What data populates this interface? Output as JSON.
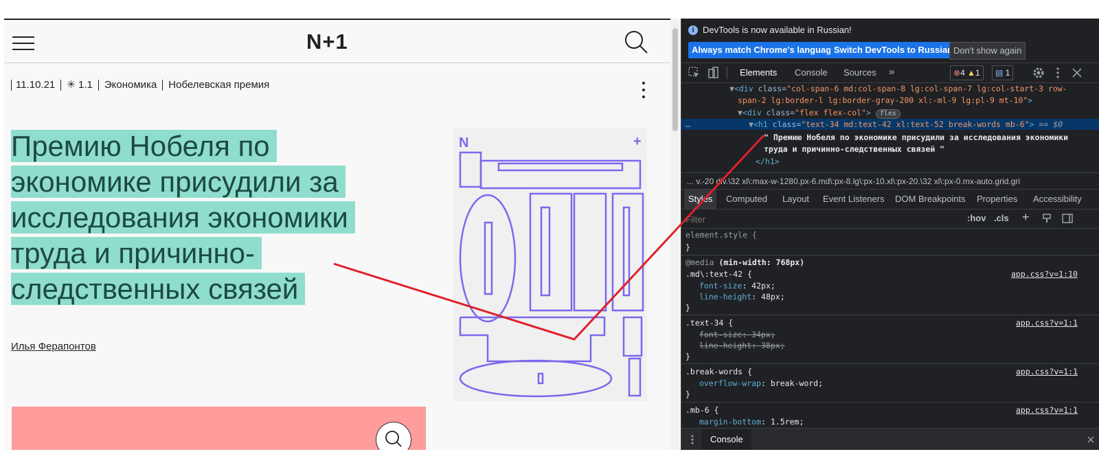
{
  "site": {
    "logo": "N+1",
    "meta": {
      "date": "11.10.21",
      "rating_icon": "asterisk-icon",
      "rating": "1.1",
      "rubric": "Экономика",
      "tag": "Нобелевская премия"
    },
    "title_lines": [
      "Премию Нобеля по",
      "экономике присудили за",
      "исследования экономики",
      "труда и причинно-",
      "следственных связей"
    ],
    "author": "Илья Ферапонтов",
    "poster": {
      "corner_left": "N",
      "corner_right": "+",
      "stroke_color": "#7b68ee"
    },
    "highlight_color": "#8fddcd",
    "pink_block_color": "#ff9c9c"
  },
  "devtools": {
    "infobar": {
      "message": "DevTools is now available in Russian!",
      "btn_match": "Always match Chrome's language",
      "btn_switch": "Switch DevTools to Russian",
      "btn_dismiss": "Don't show again"
    },
    "tabs": {
      "elements": "Elements",
      "console": "Console",
      "sources": "Sources",
      "more": "»"
    },
    "badges": {
      "errors": "4",
      "warnings": "1",
      "messages": "1"
    },
    "dom": {
      "line1_tag": "<div",
      "line1_attr": " class=",
      "line1_val": "\"col-span-6 md:col-span-8 lg:col-span-7 lg:col-start-3 row-",
      "line2_val": "span-2 lg:border-l lg:border-gray-200 xl:-ml-9 lg:pl-9 mt-10\"",
      "line2_end": ">",
      "line3_tag": "<div",
      "line3_attr": " class=",
      "line3_val": "\"flex flex-col\"",
      "line3_end": ">",
      "line3_pill": "flex",
      "line4_dots": "…",
      "line4_tag": "<h1",
      "line4_attr": " class=",
      "line4_val": "\"text-34 md:text-42 xl:text-52 break-words mb-6\"",
      "line4_end": ">",
      "line4_marker": " == $0",
      "text_line1": "\" Премию Нобеля по экономике присудили за исследования экономики",
      "text_line2": "труда и причинно-следственных связей \"",
      "close_tag": "</h1>"
    },
    "breadcrumbs": "...   v.-20   div.\\32 xl\\:max-w-1280.px-6.md\\:px-8.lg\\:px-10.xl\\:px-20.\\32 xl\\:px-0.mx-auto.grid.gri",
    "subtabs": [
      "Styles",
      "Computed",
      "Layout",
      "Event Listeners",
      "DOM Breakpoints",
      "Properties",
      "Accessibility"
    ],
    "filter_placeholder": "Filter",
    "hov": ":hov",
    "cls": ".cls",
    "rules": {
      "element_style": "element.style {",
      "close": "}",
      "media": "@media",
      "media_cond": " (min-width: 768px)",
      "r1_selector": ".md\\:text-42 {",
      "r1_link": "app.css?v=1:10",
      "r1_p1": "font-size",
      "r1_v1": "42px;",
      "r1_p2": "line-height",
      "r1_v2": "48px;",
      "r2_selector": ".text-34 {",
      "r2_link": "app.css?v=1:1",
      "r2_p1": "font-size: 34px;",
      "r2_p2": "line-height: 38px;",
      "r3_selector": ".break-words {",
      "r3_link": "app.css?v=1:1",
      "r3_p1": "overflow-wrap",
      "r3_v1": "break-word;",
      "r4_selector": ".mb-6 {",
      "r4_link": "app.css?v=1:1",
      "r4_p1": "margin-bottom",
      "r4_v1": "1.5rem;"
    },
    "console_drawer": "Console"
  },
  "colors": {
    "annotation_line": "#e0202a",
    "devtools_bg": "#202124",
    "selected_row": "#063768"
  }
}
